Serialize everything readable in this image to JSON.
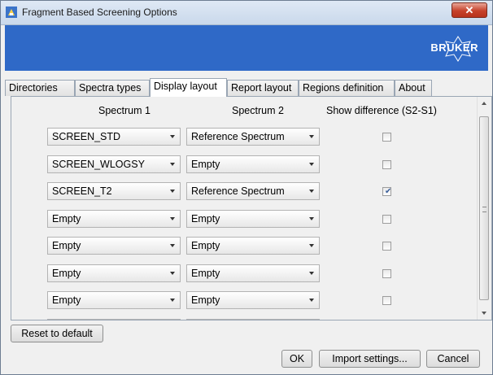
{
  "window": {
    "title": "Fragment Based Screening Options",
    "close_glyph": "✕"
  },
  "banner": {
    "logo_text": "BRUKER",
    "color": "#2f69c7"
  },
  "tabs": [
    {
      "label": "Directories"
    },
    {
      "label": "Spectra types"
    },
    {
      "label": "Display layout",
      "active": true
    },
    {
      "label": "Report layout"
    },
    {
      "label": "Regions definition"
    },
    {
      "label": "About"
    }
  ],
  "display_layout": {
    "headers": {
      "spectrum1": "Spectrum 1",
      "spectrum2": "Spectrum 2",
      "show_difference": "Show difference (S2-S1)"
    },
    "rows": [
      {
        "spectrum1": "SCREEN_STD",
        "spectrum2": "Reference Spectrum",
        "show_difference": false
      },
      {
        "spectrum1": "SCREEN_WLOGSY",
        "spectrum2": "Empty",
        "show_difference": false
      },
      {
        "spectrum1": "SCREEN_T2",
        "spectrum2": "Reference Spectrum",
        "show_difference": true
      },
      {
        "spectrum1": "Empty",
        "spectrum2": "Empty",
        "show_difference": false
      },
      {
        "spectrum1": "Empty",
        "spectrum2": "Empty",
        "show_difference": false
      },
      {
        "spectrum1": "Empty",
        "spectrum2": "Empty",
        "show_difference": false
      },
      {
        "spectrum1": "Empty",
        "spectrum2": "Empty",
        "show_difference": false
      },
      {
        "spectrum1": "Empty",
        "spectrum2": "Empty",
        "show_difference": false
      }
    ]
  },
  "buttons": {
    "reset": "Reset to default",
    "ok": "OK",
    "import": "Import settings...",
    "cancel": "Cancel"
  }
}
